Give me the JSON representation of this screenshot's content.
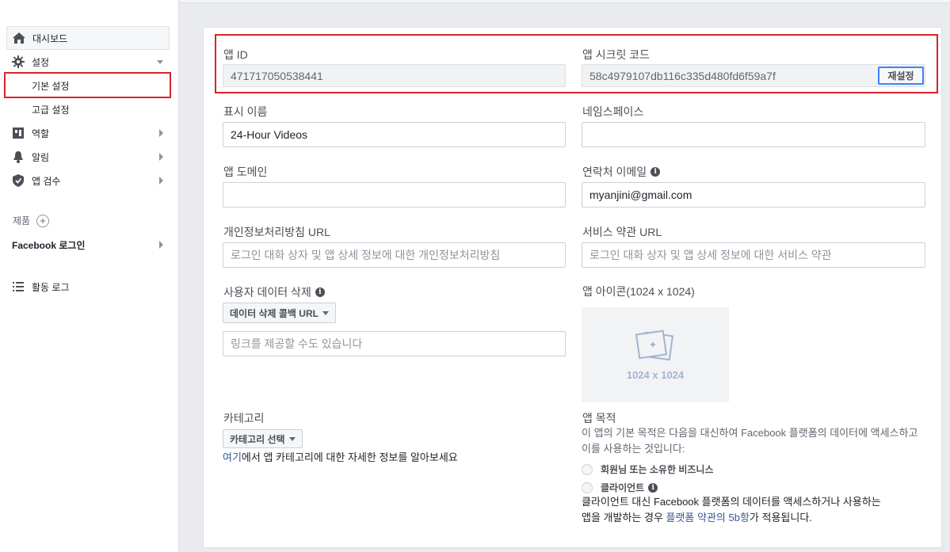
{
  "sidebar": {
    "dashboard": "대시보드",
    "settings": "설정",
    "basic_settings": "기본 설정",
    "advanced_settings": "고급 설정",
    "roles": "역할",
    "alerts": "알림",
    "app_review": "앱 검수",
    "products": "제품",
    "products_add": "+",
    "facebook_login": "Facebook 로그인",
    "activity_log": "활동 로그"
  },
  "form": {
    "app_id_label": "앱 ID",
    "app_id_value": "471717050538441",
    "app_secret_label": "앱 시크릿 코드",
    "app_secret_value": "58c4979107db116c335d480fd6f59a7f",
    "reset_button": "재설정",
    "display_name_label": "표시 이름",
    "display_name_value": "24-Hour Videos",
    "namespace_label": "네임스페이스",
    "namespace_value": "",
    "app_domains_label": "앱 도메인",
    "app_domains_value": "",
    "contact_email_label": "연락처 이메일",
    "contact_email_value": "myanjini@gmail.com",
    "privacy_url_label": "개인정보처리방침 URL",
    "privacy_url_placeholder": "로그인 대화 상자 및 앱 상세 정보에 대한 개인정보처리방침",
    "tos_url_label": "서비스 약관 URL",
    "tos_url_placeholder": "로그인 대화 상자 및 앱 상세 정보에 대한 서비스 약관",
    "data_deletion_label": "사용자 데이터 삭제",
    "data_deletion_dropdown": "데이터 삭제 콜백 URL",
    "data_deletion_placeholder": "링크를 제공할 수도 있습니다",
    "app_icon_label": "앱 아이콘(1024 x 1024)",
    "app_icon_size": "1024 x 1024",
    "category_label": "카테고리",
    "category_dropdown": "카테고리 선택",
    "category_help_link": "여기",
    "category_help_text": "에서 앱 카테고리에 대한 자세한 정보를 알아보세요",
    "app_purpose_label": "앱 목적",
    "app_purpose_desc": "이 앱의 기본 목적은 다음을 대신하여 Facebook 플랫폼의 데이터에 액세스하고 이를 사용하는 것입니다:",
    "purpose_option_1": "회원님 또는 소유한 비즈니스",
    "purpose_option_2": "클라이언트",
    "client_text_1": "클라이언트 대신 Facebook 플랫폼의 데이터를 액세스하거나 사용하는",
    "client_text_2": "앱을 개발하는 경우 ",
    "client_text_link": "플랫폼 약관의 5b항",
    "client_text_3": "가 적용됩니다."
  },
  "info_glyph": "i"
}
